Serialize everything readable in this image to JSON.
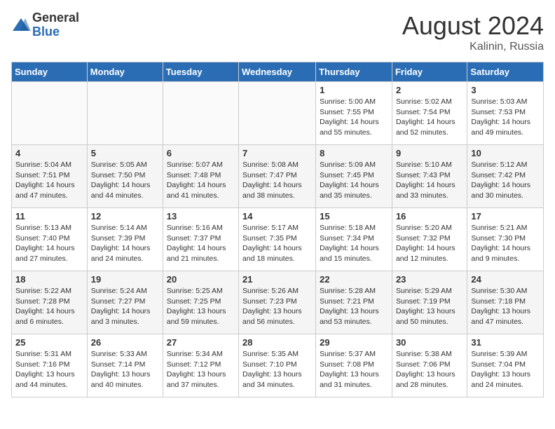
{
  "header": {
    "logo_general": "General",
    "logo_blue": "Blue",
    "month_year": "August 2024",
    "location": "Kalinin, Russia"
  },
  "days_of_week": [
    "Sunday",
    "Monday",
    "Tuesday",
    "Wednesday",
    "Thursday",
    "Friday",
    "Saturday"
  ],
  "weeks": [
    [
      {
        "day": "",
        "info": ""
      },
      {
        "day": "",
        "info": ""
      },
      {
        "day": "",
        "info": ""
      },
      {
        "day": "",
        "info": ""
      },
      {
        "day": "1",
        "info": "Sunrise: 5:00 AM\nSunset: 7:55 PM\nDaylight: 14 hours\nand 55 minutes."
      },
      {
        "day": "2",
        "info": "Sunrise: 5:02 AM\nSunset: 7:54 PM\nDaylight: 14 hours\nand 52 minutes."
      },
      {
        "day": "3",
        "info": "Sunrise: 5:03 AM\nSunset: 7:53 PM\nDaylight: 14 hours\nand 49 minutes."
      }
    ],
    [
      {
        "day": "4",
        "info": "Sunrise: 5:04 AM\nSunset: 7:51 PM\nDaylight: 14 hours\nand 47 minutes."
      },
      {
        "day": "5",
        "info": "Sunrise: 5:05 AM\nSunset: 7:50 PM\nDaylight: 14 hours\nand 44 minutes."
      },
      {
        "day": "6",
        "info": "Sunrise: 5:07 AM\nSunset: 7:48 PM\nDaylight: 14 hours\nand 41 minutes."
      },
      {
        "day": "7",
        "info": "Sunrise: 5:08 AM\nSunset: 7:47 PM\nDaylight: 14 hours\nand 38 minutes."
      },
      {
        "day": "8",
        "info": "Sunrise: 5:09 AM\nSunset: 7:45 PM\nDaylight: 14 hours\nand 35 minutes."
      },
      {
        "day": "9",
        "info": "Sunrise: 5:10 AM\nSunset: 7:43 PM\nDaylight: 14 hours\nand 33 minutes."
      },
      {
        "day": "10",
        "info": "Sunrise: 5:12 AM\nSunset: 7:42 PM\nDaylight: 14 hours\nand 30 minutes."
      }
    ],
    [
      {
        "day": "11",
        "info": "Sunrise: 5:13 AM\nSunset: 7:40 PM\nDaylight: 14 hours\nand 27 minutes."
      },
      {
        "day": "12",
        "info": "Sunrise: 5:14 AM\nSunset: 7:39 PM\nDaylight: 14 hours\nand 24 minutes."
      },
      {
        "day": "13",
        "info": "Sunrise: 5:16 AM\nSunset: 7:37 PM\nDaylight: 14 hours\nand 21 minutes."
      },
      {
        "day": "14",
        "info": "Sunrise: 5:17 AM\nSunset: 7:35 PM\nDaylight: 14 hours\nand 18 minutes."
      },
      {
        "day": "15",
        "info": "Sunrise: 5:18 AM\nSunset: 7:34 PM\nDaylight: 14 hours\nand 15 minutes."
      },
      {
        "day": "16",
        "info": "Sunrise: 5:20 AM\nSunset: 7:32 PM\nDaylight: 14 hours\nand 12 minutes."
      },
      {
        "day": "17",
        "info": "Sunrise: 5:21 AM\nSunset: 7:30 PM\nDaylight: 14 hours\nand 9 minutes."
      }
    ],
    [
      {
        "day": "18",
        "info": "Sunrise: 5:22 AM\nSunset: 7:28 PM\nDaylight: 14 hours\nand 6 minutes."
      },
      {
        "day": "19",
        "info": "Sunrise: 5:24 AM\nSunset: 7:27 PM\nDaylight: 14 hours\nand 3 minutes."
      },
      {
        "day": "20",
        "info": "Sunrise: 5:25 AM\nSunset: 7:25 PM\nDaylight: 13 hours\nand 59 minutes."
      },
      {
        "day": "21",
        "info": "Sunrise: 5:26 AM\nSunset: 7:23 PM\nDaylight: 13 hours\nand 56 minutes."
      },
      {
        "day": "22",
        "info": "Sunrise: 5:28 AM\nSunset: 7:21 PM\nDaylight: 13 hours\nand 53 minutes."
      },
      {
        "day": "23",
        "info": "Sunrise: 5:29 AM\nSunset: 7:19 PM\nDaylight: 13 hours\nand 50 minutes."
      },
      {
        "day": "24",
        "info": "Sunrise: 5:30 AM\nSunset: 7:18 PM\nDaylight: 13 hours\nand 47 minutes."
      }
    ],
    [
      {
        "day": "25",
        "info": "Sunrise: 5:31 AM\nSunset: 7:16 PM\nDaylight: 13 hours\nand 44 minutes."
      },
      {
        "day": "26",
        "info": "Sunrise: 5:33 AM\nSunset: 7:14 PM\nDaylight: 13 hours\nand 40 minutes."
      },
      {
        "day": "27",
        "info": "Sunrise: 5:34 AM\nSunset: 7:12 PM\nDaylight: 13 hours\nand 37 minutes."
      },
      {
        "day": "28",
        "info": "Sunrise: 5:35 AM\nSunset: 7:10 PM\nDaylight: 13 hours\nand 34 minutes."
      },
      {
        "day": "29",
        "info": "Sunrise: 5:37 AM\nSunset: 7:08 PM\nDaylight: 13 hours\nand 31 minutes."
      },
      {
        "day": "30",
        "info": "Sunrise: 5:38 AM\nSunset: 7:06 PM\nDaylight: 13 hours\nand 28 minutes."
      },
      {
        "day": "31",
        "info": "Sunrise: 5:39 AM\nSunset: 7:04 PM\nDaylight: 13 hours\nand 24 minutes."
      }
    ]
  ]
}
